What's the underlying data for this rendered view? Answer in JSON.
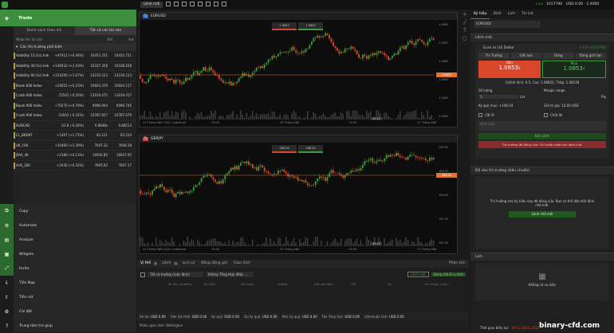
{
  "topbar": {
    "new_order_label": "Lệnh mới",
    "live_label": "Live",
    "account": "1017790",
    "balance": "USD 0.00 · 1:4000",
    "timestamp": "19:13 28.01.2024"
  },
  "market": {
    "trade_label": "Trade",
    "tab_watchlist": "Danh sách theo dõi",
    "tab_all": "Tất cả các tài sản",
    "search_placeholder": "Nhập tên tài sản",
    "col_bid": "Bid",
    "col_ask": "Ask",
    "group_label": "Các thị trường phổ biến",
    "rows": [
      {
        "name": "Volatility 15 (1s) Index",
        "change": "+47412 (+0.46%)",
        "bid": "10452.251",
        "ask": "10452.721"
      },
      {
        "name": "Volatility 30 (1s) Index",
        "change": "+146032 (+1.43%)",
        "bid": "10337.358",
        "ask": "10338.258"
      },
      {
        "name": "Volatility 90 (1s) Index",
        "change": "+224295 (+1.67%)",
        "bid": "14235.523",
        "ask": "14236.123"
      },
      {
        "name": "Boom 600 Index",
        "change": "+24052 (+0.23%)",
        "bid": "10603.379",
        "ask": "10604.157"
      },
      {
        "name": "Crash 600 Index",
        "change": "-72541 (-0.56%)",
        "bid": "13019.475",
        "ask": "13019.417"
      },
      {
        "name": "Boom 900 Index",
        "change": "+70270 (+0.78%)",
        "bid": "9096.064",
        "ask": "9096.745"
      },
      {
        "name": "Crash 900 Index",
        "change": "-33932 (-0.31%)",
        "bid": "10787.657",
        "ask": "10787.679"
      },
      {
        "name": "AUDCAD",
        "change": "-22.8 (-0.26%)",
        "bid": "0.8848s",
        "ask": "0.88513"
      },
      {
        "name": "CL_BRENT",
        "change": "+1407 (+1.72%)",
        "bid": "83.121",
        "ask": "83.234"
      },
      {
        "name": "UK_100",
        "change": "+10460 (+1.39%)",
        "bid": "7647.32",
        "ask": "7648.38"
      },
      {
        "name": "DAX_40",
        "change": "+2180 (+0.13%)",
        "bid": "16936.85",
        "ask": "16937.95"
      },
      {
        "name": "AUS_200",
        "change": "+2430 (+0.32%)",
        "bid": "7605.82",
        "ask": "7607.17"
      }
    ]
  },
  "menu": [
    {
      "label": "Copy"
    },
    {
      "label": "Automate"
    },
    {
      "label": "Analyze"
    },
    {
      "label": "Widgets"
    },
    {
      "label": "Invite"
    },
    {
      "label": "Tiền Nạp"
    },
    {
      "label": "Tiền rút"
    },
    {
      "label": "Cài đặt"
    },
    {
      "label": "Trung tâm trợ giúp"
    }
  ],
  "chart1": {
    "symbol": "EURUSD",
    "timeframe": "5m",
    "prices": [
      "1.0880",
      "1.0870",
      "1.0860",
      "1.0850",
      "1.0840",
      "1.0830"
    ],
    "current_price": "1.0853",
    "times": [
      "23 Tháng Một 2024, undefined",
      "19:00",
      "25 Tháng Một",
      "19:00",
      "27 Tháng Một"
    ],
    "countdown": "45:20",
    "bid_price": "1.0853",
    "ask_price": "1.0853"
  },
  "chart2": {
    "symbol": "GBPJPY",
    "timeframe": "5m",
    "prices": [
      "189.00",
      "188.50",
      "188.00",
      "187.50",
      "187.00"
    ],
    "current_price": "188.20",
    "times": [
      "23 Tháng Một 2024, undefined",
      "19:00",
      "25 Tháng Một",
      "19:00",
      "27 Tháng Một"
    ],
    "countdown": "45:20",
    "bid_price": "188.16",
    "ask_price": "188.20"
  },
  "bottom": {
    "tabs": [
      "Vị thế",
      "Lệnh",
      "Lịch sử",
      "Bảng động giá",
      "Giao dịch"
    ],
    "tab_counts": [
      "0",
      "0"
    ],
    "analyze_label": "Phân tích",
    "filter_market": "Tất cả trường (mặc định)",
    "filter_group": "Không Tổng Hợp (Mặc ...",
    "btn_new": "Lệnh mới",
    "btn_close_all": "Đóng (đã lỗ vị thế)",
    "cols": [
      "Tài sản (undefin...",
      "Ký hiệu",
      "Số lượng",
      "Hướng",
      "Giá vào lệnh",
      "T/P",
      "S/L",
      "Lời nhuận ròng..."
    ],
    "status": [
      {
        "k": "Số dư:",
        "v": "USD 0.00"
      },
      {
        "k": "Vốn tức thời:",
        "v": "USD 0.00"
      },
      {
        "k": "Ký quỹ:",
        "v": "USD 0.00"
      },
      {
        "k": "Dư ký quỹ:",
        "v": "USD 0.00"
      },
      {
        "k": "Mức ký quỹ:",
        "v": "USD 0.00"
      },
      {
        "k": "Fair Stop Out:",
        "v": "USD 0.00"
      },
      {
        "k": "Lời/nhuận tích:",
        "v": "USD 0.00"
      }
    ],
    "trading_session": "Phiên giao dịch: Wellington"
  },
  "right": {
    "tabs": [
      "Ký hiệu",
      "Dinh",
      "Lịch",
      "Tin tức"
    ],
    "symbol": "EURUSD",
    "new_order_title": "Lệnh mới",
    "instrument": "Euro vs US Dollar",
    "instrument_change": "+7.6 (+0.07%)",
    "order_tabs": [
      "Thị Trường",
      "Giới hạn",
      "Dừng",
      "Dừng giới hạn"
    ],
    "sell_label": "Bán",
    "sell_price": "1.0853",
    "sell_sup": "2",
    "buy_label": "Mua",
    "buy_price": "1.0853",
    "buy_sup": "7",
    "spread": "Chênh lệch: 0.5; Cao: 1.08852; Thấp: 1.08128",
    "qty_label": "Số lượng",
    "qty_value": "1",
    "qty_unit": "Lot",
    "margin_order_label": "Margin range",
    "pip_label": "Pip",
    "margin_label": "Ký quỹ mục: +106.54",
    "valid_label": "Giá trị pip: 10.00 USD",
    "sl_label": "Cắt lỗ",
    "tp_label": "Chốt lời",
    "desc_placeholder": "Bình luận",
    "place_btn": "Đặt Lệnh",
    "closed_msg": "Thị trường đã đóng cửa. Chỉ chấp nhận các lệnh chờ.",
    "depth_title": "Độ sâu thị trường (tiêu chuẩn)",
    "depth_msg": "Thị trường cho ký hiệu này đã đóng cửa. Bạn có thể đặt một lệnh chờ mới.",
    "depth_btn": "Lệnh chờ mới",
    "calendar_title": "Lịch",
    "calendar_msg": "Không có sự kiện",
    "server_time_label": "Thời gian biểu tại:",
    "server_time": "19:13 28.01.2024"
  },
  "footer": {
    "brand": "binary-cfd.com"
  },
  "colors": {
    "green": "#3c9a3c",
    "red": "#d9472b",
    "orange": "#e6732d",
    "accent": "#e8c24a"
  }
}
